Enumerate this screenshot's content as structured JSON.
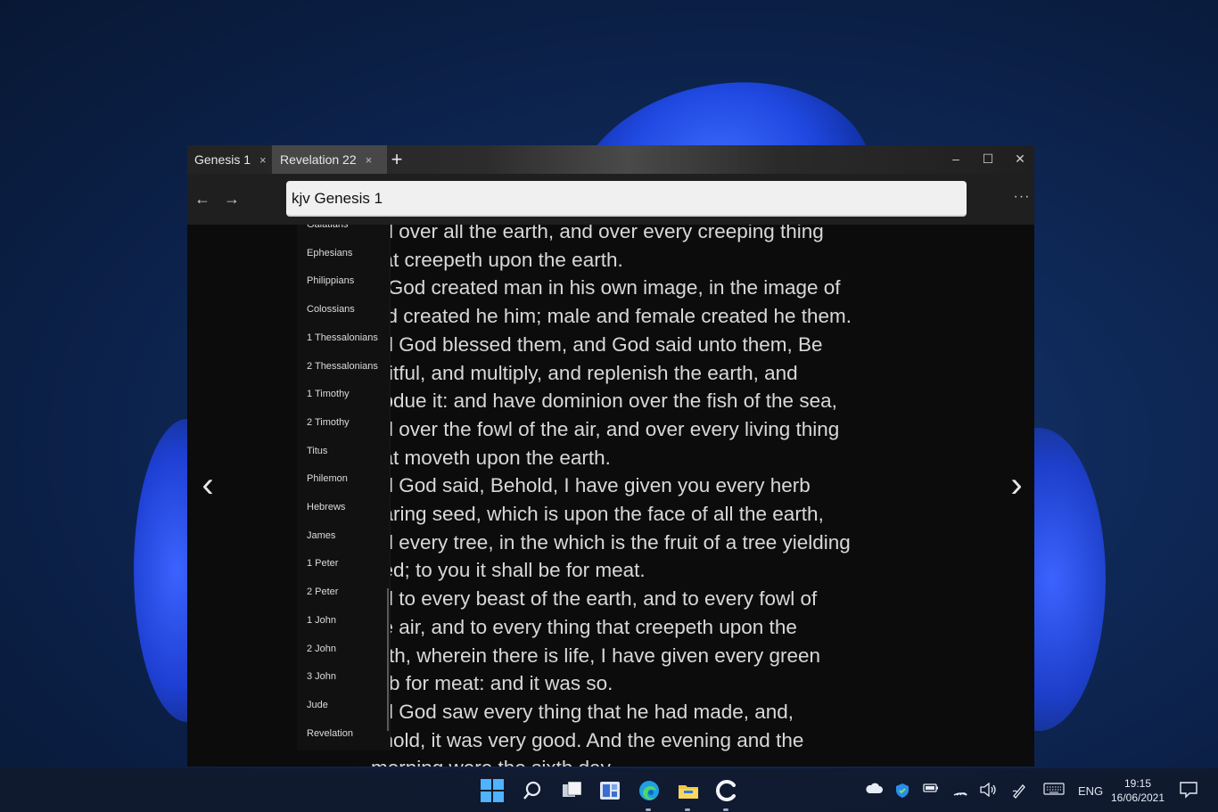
{
  "tabs": [
    {
      "label": "Genesis 1",
      "close": "×"
    },
    {
      "label": "Revelation 22",
      "close": "×"
    }
  ],
  "new_tab_glyph": "+",
  "window_controls": {
    "minimize": "–",
    "maximize": "☐",
    "close": "✕"
  },
  "nav": {
    "back": "←",
    "forward": "→"
  },
  "address_value": "kjv  Genesis  1",
  "more_glyph": "···",
  "books": [
    "Galatians",
    "Ephesians",
    "Philippians",
    "Colossians",
    "1 Thessalonians",
    "2 Thessalonians",
    "1 Timothy",
    "2 Timothy",
    "Titus",
    "Philemon",
    "Hebrews",
    "James",
    "1 Peter",
    "2 Peter",
    "1 John",
    "2 John",
    "3 John",
    "Jude",
    "Revelation"
  ],
  "verses": [
    "nd over all the earth, and over every creeping thing",
    "hat creepeth upon the earth.",
    "o God created man in his own image, in the image of",
    "iod created he him; male and female created he them.",
    "nd God blessed them, and God said unto them, Be",
    "ruitful, and multiply, and replenish the earth, and",
    "ubdue it: and have dominion over the fish of the sea,",
    "nd over the fowl of the air, and over every living thing",
    "hat moveth upon the earth.",
    "nd God said, Behold, I have given you every herb",
    "earing seed, which is upon the face of all the earth,",
    "nd every tree, in the which is the fruit of a tree yielding",
    "eed; to you it shall be for meat.",
    "nd to every beast of the earth, and to every fowl of",
    "he air, and to every thing that creepeth upon the",
    "arth, wherein there is life, I have given every green",
    "erb for meat: and it was so.",
    "nd God saw every thing that he had made, and,",
    "ehold, it was very good. And the evening and the",
    "morning were the sixth day."
  ],
  "pager": {
    "prev": "‹",
    "next": "›"
  },
  "taskbar": {
    "tray_lang": "ENG",
    "time": "19:15",
    "date": "16/06/2021"
  },
  "colors": {
    "accent": "#4fb3ff",
    "window_bg": "#0c0c0c",
    "address_bg": "#f0f0f0"
  }
}
